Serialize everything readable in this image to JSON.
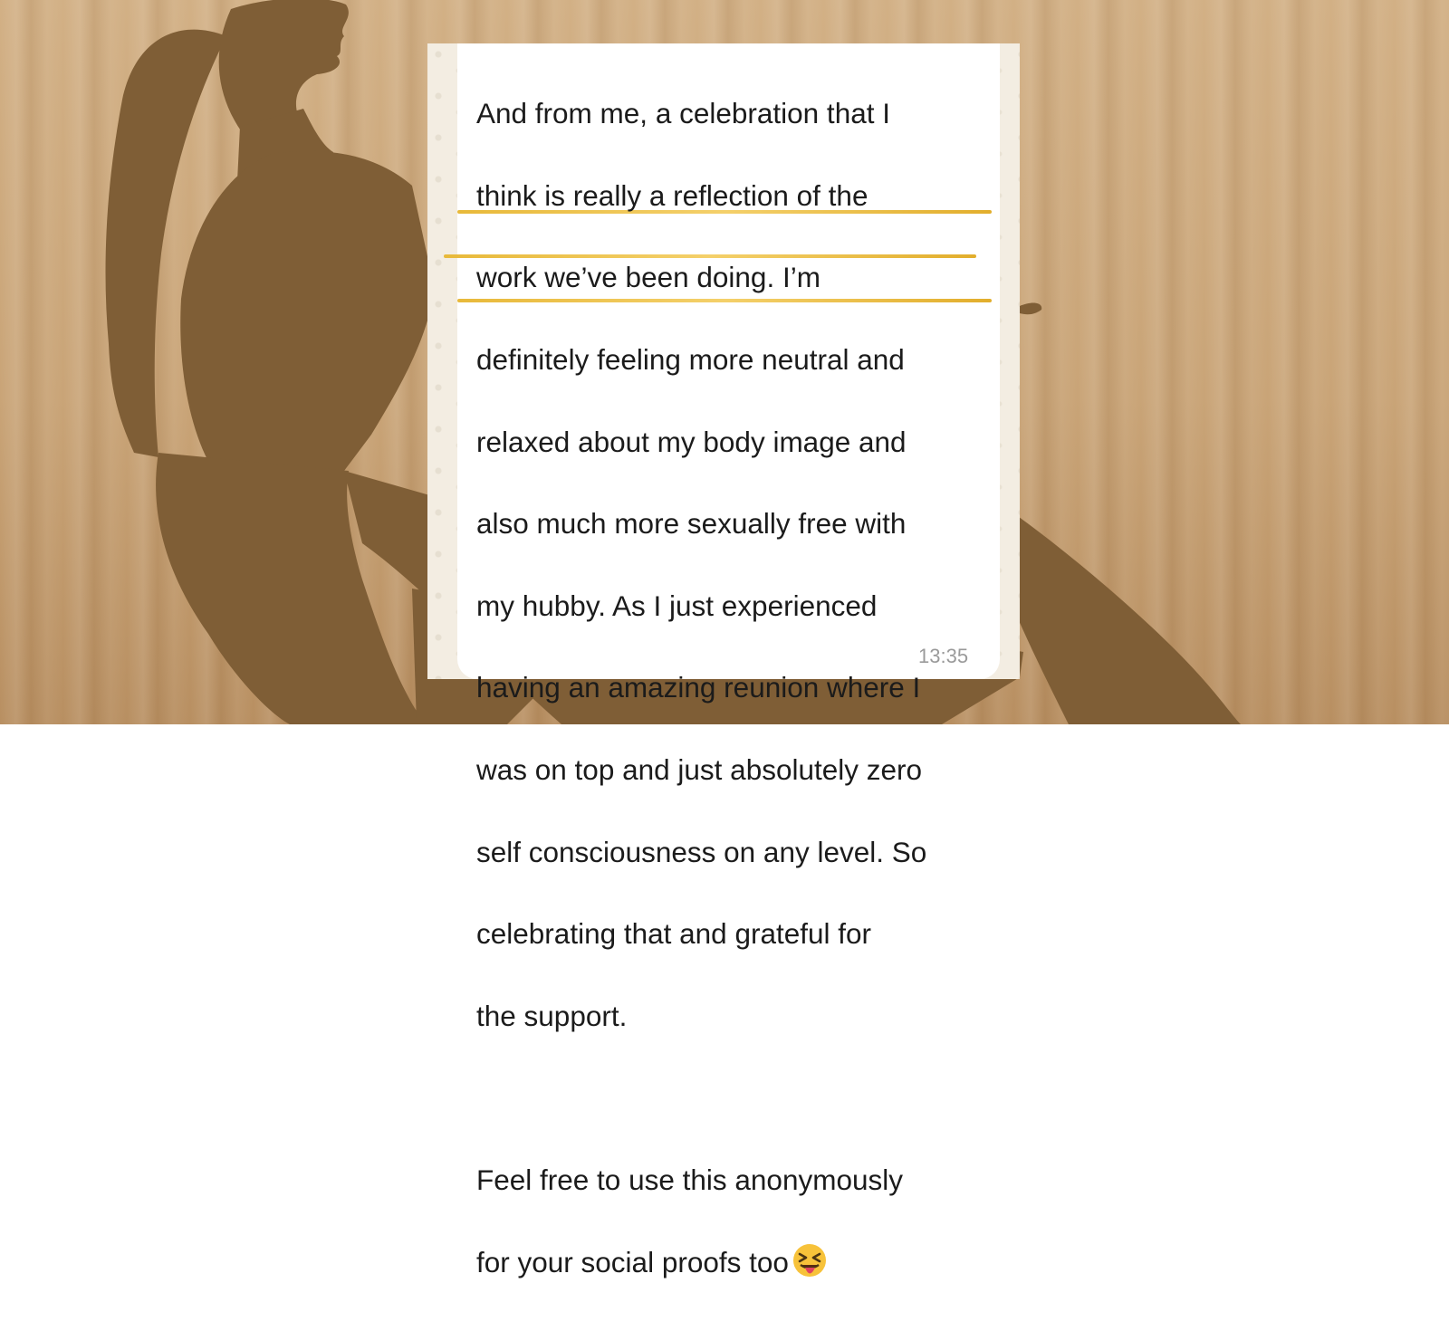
{
  "colors": {
    "background": "#c9a477",
    "silhouette": "#7f5e36",
    "bubble": "#ffffff",
    "chat_wallpaper": "#f3ede2",
    "highlight": "#e8b93a",
    "text": "#1b1b1b",
    "timestamp": "#9a9a9a"
  },
  "message": {
    "lines": [
      "And from me, a celebration that I",
      "think is really a reflection of the",
      "work we’ve been doing. I’m",
      "definitely feeling more neutral and",
      "relaxed about my body image and",
      "also much more sexually free with",
      "my hubby. As I just experienced",
      "having an amazing reunion where I",
      "was on top and just absolutely zero",
      "self consciousness on any level. So",
      "celebrating that and grateful for",
      "the support."
    ],
    "closing_lines": [
      "Feel free to use this anonymously",
      "for your social proofs too"
    ],
    "emoji": "squinting-face-with-tongue-icon",
    "timestamp": "13:35"
  }
}
